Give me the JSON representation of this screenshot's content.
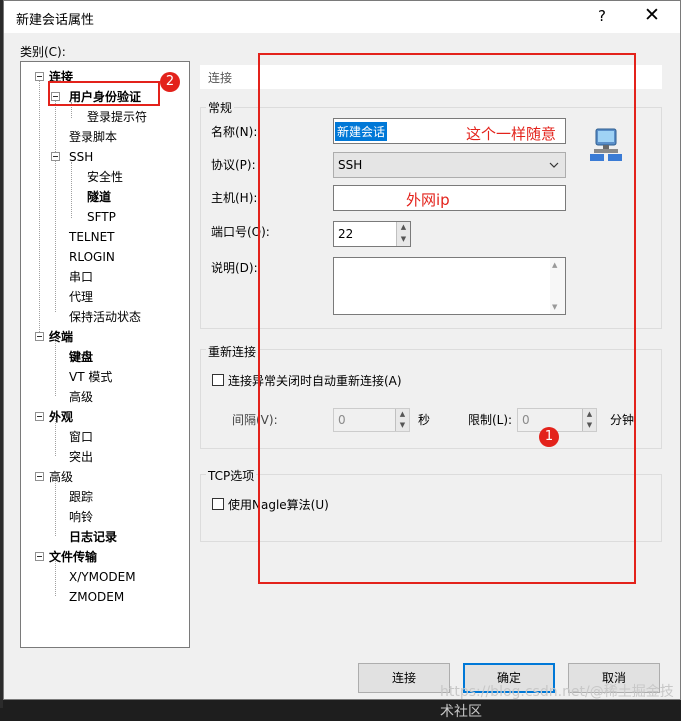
{
  "dialog": {
    "title": "新建会话属性",
    "help_glyph": "?",
    "close_glyph": "✕"
  },
  "sidebar": {
    "category_label": "类别(C):",
    "nodes": [
      {
        "label": "连接",
        "bold": true
      },
      {
        "label": "用户身份验证",
        "bold": true
      },
      {
        "label": "登录提示符",
        "bold": false
      },
      {
        "label": "登录脚本",
        "bold": false
      },
      {
        "label": "SSH",
        "bold": false
      },
      {
        "label": "安全性",
        "bold": false
      },
      {
        "label": "隧道",
        "bold": true
      },
      {
        "label": "SFTP",
        "bold": false
      },
      {
        "label": "TELNET",
        "bold": false
      },
      {
        "label": "RLOGIN",
        "bold": false
      },
      {
        "label": "串口",
        "bold": false
      },
      {
        "label": "代理",
        "bold": false
      },
      {
        "label": "保持活动状态",
        "bold": false
      },
      {
        "label": "终端",
        "bold": true
      },
      {
        "label": "键盘",
        "bold": true
      },
      {
        "label": "VT 模式",
        "bold": false
      },
      {
        "label": "高级",
        "bold": false
      },
      {
        "label": "外观",
        "bold": true
      },
      {
        "label": "窗口",
        "bold": false
      },
      {
        "label": "突出",
        "bold": false
      },
      {
        "label": "高级",
        "bold": false
      },
      {
        "label": "跟踪",
        "bold": false
      },
      {
        "label": "响铃",
        "bold": false
      },
      {
        "label": "日志记录",
        "bold": true
      },
      {
        "label": "文件传输",
        "bold": true
      },
      {
        "label": "X/YMODEM",
        "bold": false
      },
      {
        "label": "ZMODEM",
        "bold": false
      }
    ]
  },
  "main": {
    "header": "连接",
    "general": {
      "title": "常规",
      "name_label": "名称(N):",
      "name_value": "新建会话",
      "protocol_label": "协议(P):",
      "protocol_value": "SSH",
      "host_label": "主机(H):",
      "host_value": "",
      "port_label": "端口号(O):",
      "port_value": "22",
      "desc_label": "说明(D):",
      "desc_value": ""
    },
    "reconnect": {
      "title": "重新连接",
      "checkbox_label": "连接异常关闭时自动重新连接(A)",
      "interval_label": "间隔(V):",
      "interval_value": "0",
      "interval_unit": "秒",
      "limit_label": "限制(L):",
      "limit_value": "0",
      "limit_unit": "分钟"
    },
    "tcp": {
      "title": "TCP选项",
      "nagle_label": "使用Nagle算法(U)"
    }
  },
  "annotations": {
    "name_note": "这个一样随意",
    "host_note": "外网ip",
    "badge_1": "1",
    "badge_2": "2"
  },
  "buttons": {
    "connect": "连接",
    "ok": "确定",
    "cancel": "取消"
  },
  "watermark": "https://blog.csdn.net/@稀土掘金技术社区"
}
